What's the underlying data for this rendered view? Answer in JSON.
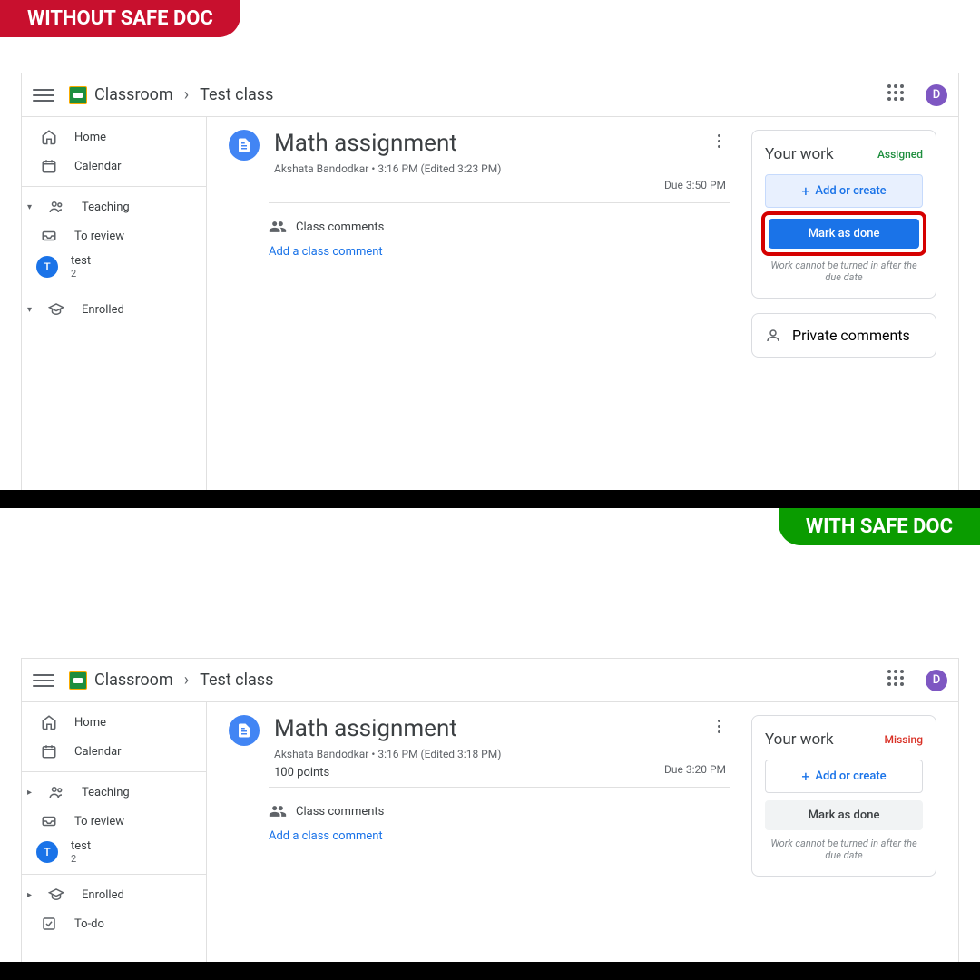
{
  "banners": {
    "without": "WITHOUT SAFE DOC",
    "with": "WITH SAFE DOC"
  },
  "header": {
    "classroom": "Classroom",
    "class_name": "Test class",
    "avatar_letter": "D"
  },
  "sidebar": {
    "home": "Home",
    "calendar": "Calendar",
    "teaching": "Teaching",
    "to_review": "To review",
    "class_letter": "T",
    "class_name": "test",
    "class_count": "2",
    "enrolled": "Enrolled",
    "todo": "To-do"
  },
  "assignment_top": {
    "title": "Math assignment",
    "author": "Akshata Bandodkar",
    "time": "3:16 PM (Edited 3:23 PM)",
    "due": "Due 3:50 PM",
    "comments_label": "Class comments",
    "add_comment": "Add a class comment"
  },
  "assignment_bottom": {
    "title": "Math assignment",
    "author": "Akshata Bandodkar",
    "time": "3:16 PM (Edited 3:18 PM)",
    "points": "100 points",
    "due": "Due 3:20 PM",
    "comments_label": "Class comments",
    "add_comment": "Add a class comment"
  },
  "work_card": {
    "title": "Your work",
    "assigned": "Assigned",
    "missing": "Missing",
    "add_create": "Add or create",
    "mark_done": "Mark as done",
    "note": "Work cannot be turned in after the due date",
    "private": "Private comments"
  }
}
